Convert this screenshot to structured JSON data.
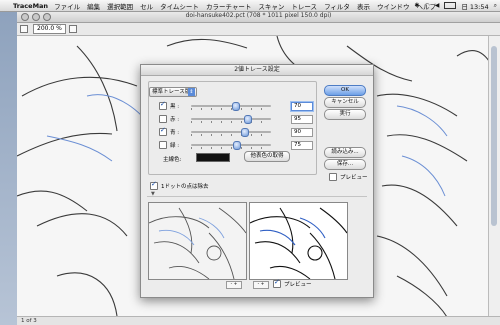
{
  "menubar": {
    "apple": "",
    "app_name": "TraceMan",
    "items": [
      "ファイル",
      "編集",
      "選択範囲",
      "セル",
      "タイムシート",
      "カラーチャート",
      "スキャン",
      "トレース",
      "フィルタ",
      "表示",
      "ウインドウ",
      "ヘルプ"
    ],
    "clock": "日 13:54"
  },
  "document": {
    "title": "doi-hansuke402.pct (708 * 1011 pixel 150.0 dpi)",
    "zoom": "200.0 %",
    "status": "1 of 3"
  },
  "dialog": {
    "title": "2値トレース設定",
    "mode_popup": "標準トレース版",
    "rows": [
      {
        "label": "黒 :",
        "checked": true,
        "value": "70",
        "fraction": 0.55
      },
      {
        "label": "赤 :",
        "checked": false,
        "value": "95",
        "fraction": 0.72
      },
      {
        "label": "青 :",
        "checked": true,
        "value": "90",
        "fraction": 0.67
      },
      {
        "label": "緑 :",
        "checked": false,
        "value": "75",
        "fraction": 0.57
      }
    ],
    "main_color_label": "主線色:",
    "main_color": "#111111",
    "pick_button": "他表色の取得",
    "buttons": {
      "ok": "OK",
      "cancel": "キャンセル",
      "apply": "実行",
      "load": "読み込み...",
      "save": "保存..."
    },
    "preview_label": "プレビュー",
    "dot_removal_label": "1ドットの点は除去",
    "bottom_preview_label": "プレビュー"
  }
}
